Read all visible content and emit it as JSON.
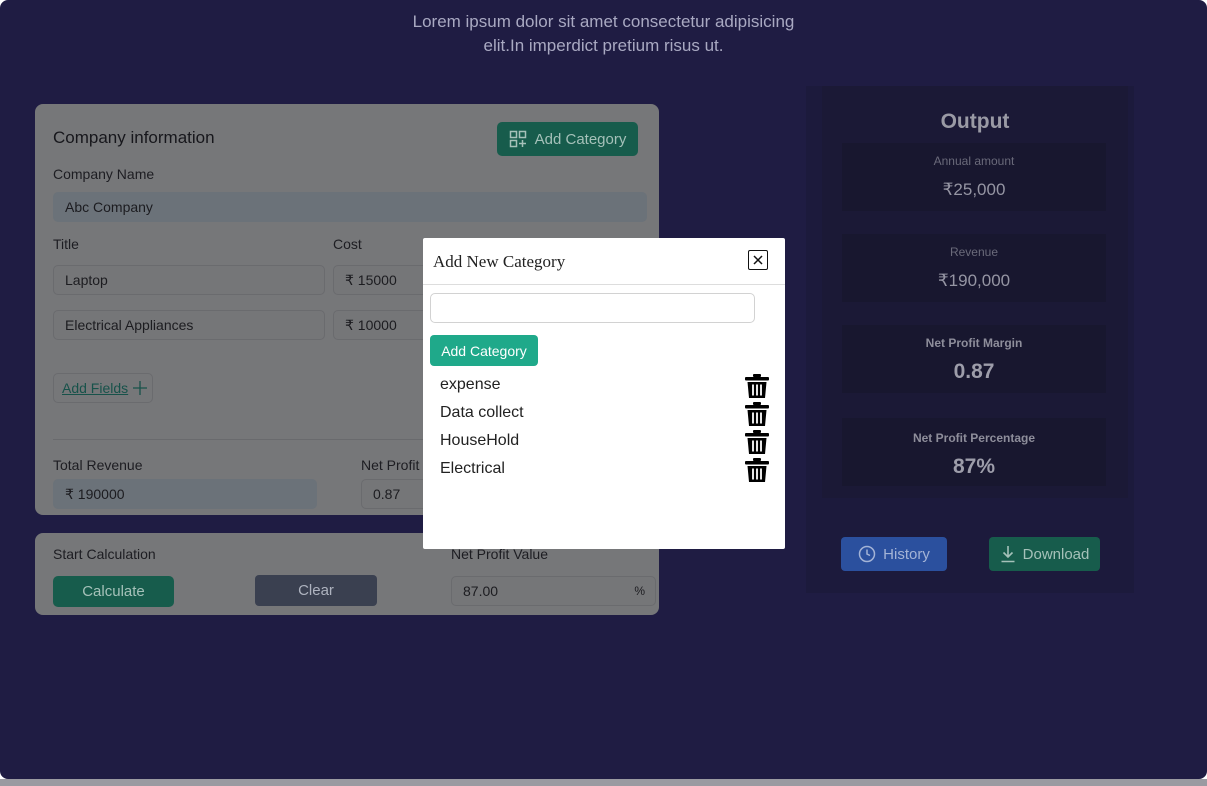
{
  "intro": {
    "line1": "Lorem ipsum dolor sit amet consectetur adipisicing",
    "line2": "elit.In imperdict pretium risus ut."
  },
  "company": {
    "title": "Company information",
    "add_category_label": "Add Category",
    "company_name_label": "Company Name",
    "company_name_value": "Abc Company",
    "title_col_label": "Title",
    "cost_col_label": "Cost",
    "rows": [
      {
        "title": "Laptop",
        "cost": "₹ 15000"
      },
      {
        "title": "Electrical Appliances",
        "cost": "₹ 10000"
      }
    ],
    "add_fields_label": "Add Fields",
    "total_revenue_label": "Total Revenue",
    "total_revenue_value": "₹ 190000",
    "net_profit_label": "Net Profit",
    "net_profit_value": "0.87"
  },
  "calculation": {
    "start_label": "Start Calculation",
    "calculate_label": "Calculate",
    "clear_label": "Clear",
    "net_profit_value_label": "Net Profit Value",
    "net_profit_value": "87.00",
    "percent_suffix": "%"
  },
  "output": {
    "title": "Output",
    "annual_label": "Annual amount",
    "annual_value": "₹25,000",
    "revenue_label": "Revenue",
    "revenue_value": "₹190,000",
    "margin_label": "Net Profit Margin",
    "margin_value": "0.87",
    "percentage_label": "Net Profit Percentage",
    "percentage_value": "87%",
    "history_label": "History",
    "download_label": "Download"
  },
  "modal": {
    "title": "Add New Category",
    "input_value": "",
    "add_label": "Add Category",
    "categories": [
      "expense",
      "Data collect",
      "HouseHold",
      "Electrical"
    ]
  },
  "colors": {
    "page_bg": "#1f1c43",
    "accent_green": "#1fa98a",
    "accent_blue": "#2b509e"
  }
}
